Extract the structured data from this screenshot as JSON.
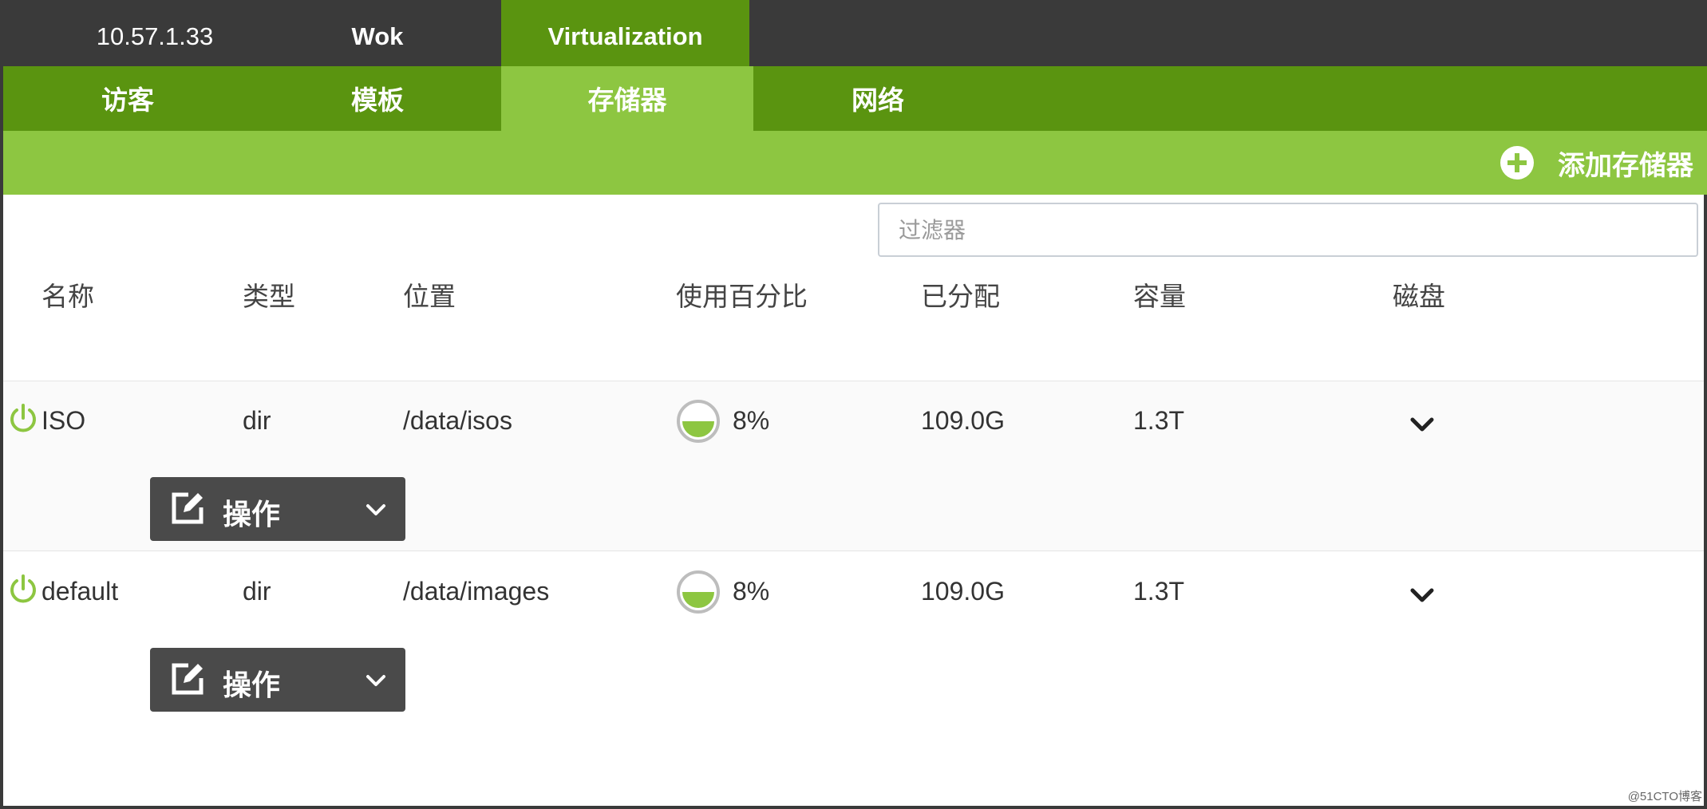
{
  "topbar": {
    "host": "10.57.1.33",
    "wok": "Wok",
    "virtualization": "Virtualization"
  },
  "tabs": [
    {
      "label": "访客"
    },
    {
      "label": "模板"
    },
    {
      "label": "存储器",
      "active": true
    },
    {
      "label": "网络"
    }
  ],
  "actions": {
    "add_storage": "添加存储器"
  },
  "filter": {
    "placeholder": "过滤器",
    "value": ""
  },
  "table": {
    "headers": [
      "名称",
      "类型",
      "位置",
      "使用百分比",
      "已分配",
      "容量",
      "磁盘"
    ],
    "rows": [
      {
        "name": "ISO",
        "type": "dir",
        "location": "/data/isos",
        "usage": "8%",
        "usage_fraction": 0.08,
        "allocated": "109.0G",
        "capacity": "1.3T",
        "status": "active",
        "ops_label": "操作"
      },
      {
        "name": "default",
        "type": "dir",
        "location": "/data/images",
        "usage": "8%",
        "usage_fraction": 0.08,
        "allocated": "109.0G",
        "capacity": "1.3T",
        "status": "active",
        "ops_label": "操作"
      }
    ]
  },
  "colors": {
    "dark": "#3a3a3a",
    "green_dark": "#5a9410",
    "green_light": "#8dc641"
  },
  "watermark": "@51CTO博客"
}
